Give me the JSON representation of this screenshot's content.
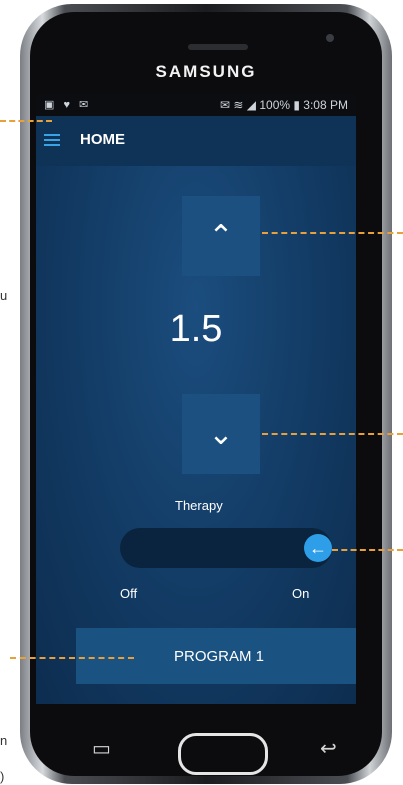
{
  "device": {
    "brand": "SAMSUNG"
  },
  "statusbar": {
    "left_icons": "▣ ♥ ✉",
    "right_text": "✉ ≋ ◢ 100% ▮ 3:08 PM"
  },
  "appbar": {
    "title": "HOME"
  },
  "control": {
    "value": "1.5",
    "up_icon": "⌃",
    "down_icon": "⌄"
  },
  "therapy": {
    "label": "Therapy",
    "off_label": "Off",
    "on_label": "On",
    "state": "on",
    "knob_icon": "←"
  },
  "program": {
    "label": "PROGRAM 1"
  },
  "side_text": {
    "left_1": "u",
    "left_2": "n",
    "left_3": ")"
  },
  "colors": {
    "screen_bg": "#123a63",
    "button_bg": "#1b5080",
    "accent_blue": "#2e9ee8",
    "callout": "#e8a13a"
  }
}
